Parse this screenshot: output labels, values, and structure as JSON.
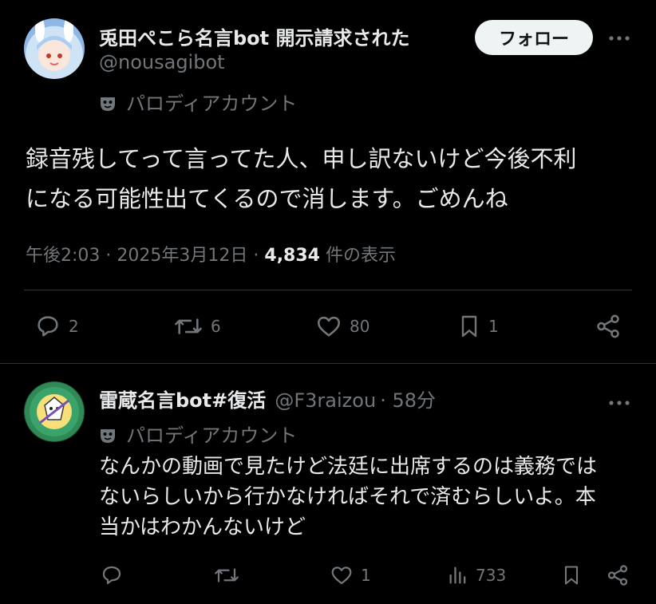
{
  "main_tweet": {
    "author_name": "兎田ぺこら名言bot 開示請求された",
    "handle": "@nousagibot",
    "parody_label": "パロディアカウント",
    "follow_label": "フォロー",
    "more_icon": "more-horizontal-icon",
    "text_line1": "録音残してって言ってた人、申し訳ないけど今後不利",
    "text_line2": "になる可能性出てくるので消します。ごめんね",
    "time": "午後2:03",
    "date": "2025年3月12日",
    "views": "4,834",
    "views_label": "件の表示",
    "replies": "2",
    "reposts": "6",
    "likes": "80",
    "bookmarks": "1"
  },
  "reply": {
    "author_name": "雷蔵名言bot#復活",
    "handle": "@F3raizou",
    "time_ago": "58分",
    "parody_label": "パロディアカウント",
    "text_line1": "なんかの動画で見たけど法廷に出席するのは義務では",
    "text_line2": "ないらしいから行かなければそれで済むらしいよ。本",
    "text_line3": "当かはわかんないけど",
    "likes": "1",
    "views": "733"
  },
  "colors": {
    "background": "#000000",
    "text": "#e7e9ea",
    "muted": "#71767b",
    "divider": "#2f3336",
    "follow_bg": "#eff3f4"
  }
}
